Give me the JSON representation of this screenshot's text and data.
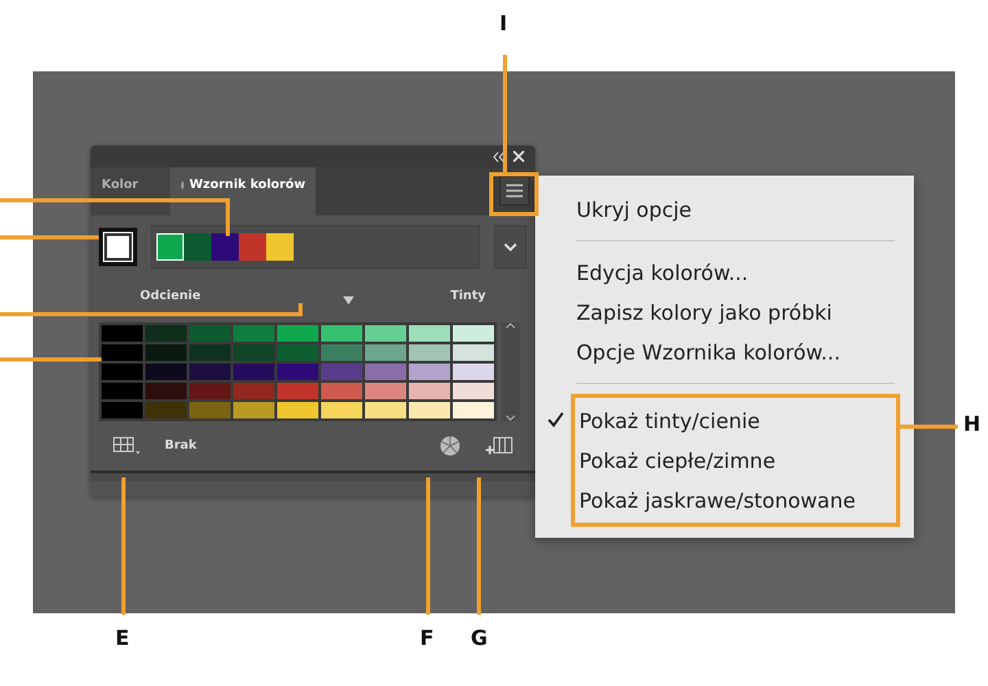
{
  "panel": {
    "tabs": [
      {
        "label": "Kolor",
        "selected": false
      },
      {
        "label": "Wzornik kolorów",
        "selected": true
      }
    ],
    "base_swatch": {
      "color": "#ffffff"
    },
    "harmony": [
      {
        "color": "#10a84e",
        "selected": true
      },
      {
        "color": "#0c5a30",
        "selected": false
      },
      {
        "color": "#2e0a78",
        "selected": false
      },
      {
        "color": "#c0342a",
        "selected": false
      },
      {
        "color": "#f0c62e",
        "selected": false
      }
    ],
    "left_label": "Odcienie",
    "right_label": "Tinty",
    "grid": [
      [
        {
          "color": "#000000"
        },
        {
          "color": "#0f2e1c"
        },
        {
          "color": "#0c5a30"
        },
        {
          "color": "#0e7e3e"
        },
        {
          "color": "#10a84e"
        },
        {
          "color": "#38c071"
        },
        {
          "color": "#66cf95"
        },
        {
          "color": "#9ddeb8"
        },
        {
          "color": "#cdeedd"
        }
      ],
      [
        {
          "color": "#000000"
        },
        {
          "color": "#0a1a10"
        },
        {
          "color": "#0e321e"
        },
        {
          "color": "#0f4526"
        },
        {
          "color": "#0e5e32"
        },
        {
          "color": "#3b8060"
        },
        {
          "color": "#6ea68b"
        },
        {
          "color": "#a2c4b2"
        },
        {
          "color": "#d3e2da"
        }
      ],
      [
        {
          "color": "#000000"
        },
        {
          "color": "#0e0a1e"
        },
        {
          "color": "#1c0f40"
        },
        {
          "color": "#260c5c"
        },
        {
          "color": "#2e0a78"
        },
        {
          "color": "#5a3c8c"
        },
        {
          "color": "#8a6eaa"
        },
        {
          "color": "#b2a2cc"
        },
        {
          "color": "#dcd6ea"
        }
      ],
      [
        {
          "color": "#000000"
        },
        {
          "color": "#2e0e0c"
        },
        {
          "color": "#621814"
        },
        {
          "color": "#912820"
        },
        {
          "color": "#c0342a"
        },
        {
          "color": "#cf5a4e"
        },
        {
          "color": "#dc8680"
        },
        {
          "color": "#e8b4b0"
        },
        {
          "color": "#f2dcd8"
        }
      ],
      [
        {
          "color": "#000000"
        },
        {
          "color": "#3e3208"
        },
        {
          "color": "#7a6414"
        },
        {
          "color": "#b89a24"
        },
        {
          "color": "#f0c62e"
        },
        {
          "color": "#f4d45a"
        },
        {
          "color": "#f6de84"
        },
        {
          "color": "#f9e9ae"
        },
        {
          "color": "#fcf4d8"
        }
      ]
    ],
    "limit_label": "Brak"
  },
  "menu": {
    "groups": [
      {
        "highlighted": false,
        "items": [
          {
            "label": "Ukryj opcje",
            "checked": false
          }
        ]
      },
      {
        "highlighted": false,
        "items": [
          {
            "label": "Edycja kolorów...",
            "checked": false
          },
          {
            "label": "Zapisz kolory jako próbki",
            "checked": false
          },
          {
            "label": "Opcje Wzornika kolorów...",
            "checked": false
          }
        ]
      },
      {
        "highlighted": true,
        "items": [
          {
            "label": "Pokaż tinty/cienie",
            "checked": true
          },
          {
            "label": "Pokaż ciepłe/zimne",
            "checked": false
          },
          {
            "label": "Pokaż jaskrawe/stonowane",
            "checked": false
          }
        ]
      }
    ]
  },
  "callouts": [
    {
      "label": "I"
    },
    {
      "label": "H"
    },
    {
      "label": "E"
    },
    {
      "label": "F"
    },
    {
      "label": "G"
    }
  ]
}
